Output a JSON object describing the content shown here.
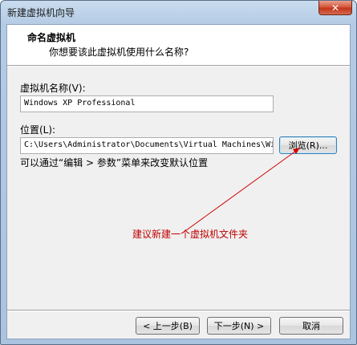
{
  "window": {
    "title": "新建虚拟机向导",
    "close_glyph": "✕"
  },
  "header": {
    "title": "命名虚拟机",
    "subtitle": "你想要该此虚拟机使用什么名称?"
  },
  "form": {
    "name_label": "虚拟机名称(V):",
    "name_value": "Windows XP Professional",
    "location_label": "位置(L):",
    "location_value": "C:\\Users\\Administrator\\Documents\\Virtual Machines\\Wi",
    "browse_label": "浏览(R)...",
    "hint": "可以通过“编辑 > 参数”菜单来改变默认位置"
  },
  "annotation": {
    "text": "建议新建一个虚拟机文件夹",
    "color": "#c00000"
  },
  "footer": {
    "back_label": "< 上一步(B)",
    "next_label": "下一步(N) >",
    "cancel_label": "取消"
  }
}
